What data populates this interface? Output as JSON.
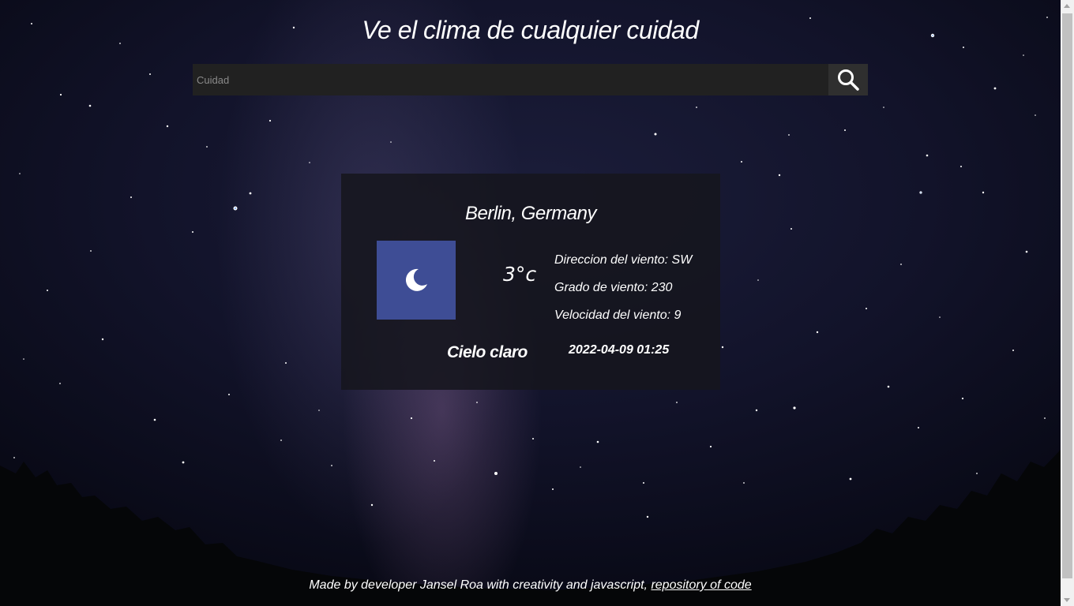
{
  "header": {
    "title": "Ve el clima de cualquier cuidad"
  },
  "search": {
    "placeholder": "Cuidad",
    "value": ""
  },
  "weather": {
    "location": "Berlin, Germany",
    "icon": "moon-icon",
    "temperature": "3°c",
    "wind_direction": "Direccion del viento: SW",
    "wind_degree": "Grado de viento: 230",
    "wind_speed": "Velocidad del viento: 9",
    "description": "Cielo claro",
    "datetime": "2022-04-09 01:25"
  },
  "footer": {
    "text": "Made by developer Jansel Roa with creativity and javascript, ",
    "link_label": "repository of code"
  },
  "colors": {
    "icon_box": "#3e4d95",
    "input_bg": "#212121",
    "button_bg": "#2f2f2f"
  }
}
